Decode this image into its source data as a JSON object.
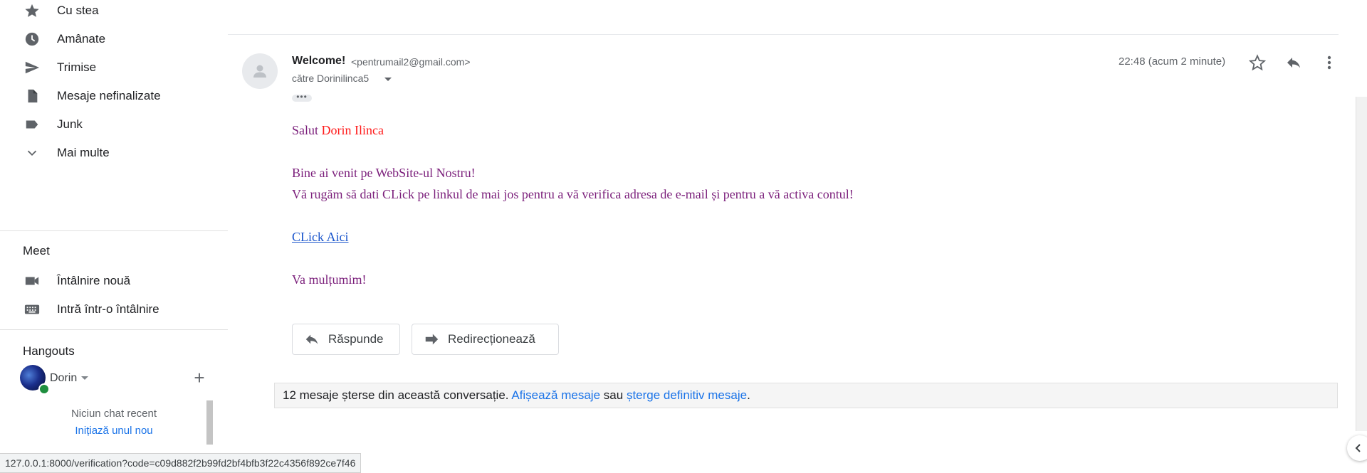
{
  "sidebar": {
    "items": [
      {
        "label": "Cu stea",
        "icon": "star-icon"
      },
      {
        "label": "Amânate",
        "icon": "clock-icon"
      },
      {
        "label": "Trimise",
        "icon": "send-icon"
      },
      {
        "label": "Mesaje nefinalizate",
        "icon": "draft-icon"
      },
      {
        "label": "Junk",
        "icon": "label-icon"
      },
      {
        "label": "Mai multe",
        "icon": "chevron-down-icon"
      }
    ],
    "meet": {
      "title": "Meet",
      "items": [
        {
          "label": "Întâlnire nouă",
          "icon": "video-icon"
        },
        {
          "label": "Intră într-o întâlnire",
          "icon": "keyboard-icon"
        }
      ]
    },
    "hangouts": {
      "title": "Hangouts",
      "user": "Dorin",
      "no_chat": "Niciun chat recent",
      "start_chat": "Inițiază unul nou"
    }
  },
  "message": {
    "sender_name": "Welcome!",
    "sender_email": "<pentrumail2@gmail.com>",
    "recipient": "către Dorinilinca5",
    "timestamp": "22:48 (acum 2 minute)",
    "greeting_prefix": "Salut ",
    "greeting_name": "Dorin Ilinca",
    "line1": "Bine ai venit pe WebSite-ul Nostru!",
    "line2": "Vă rugăm să dati CLick pe linkul de mai jos pentru a vă verifica adresa de e-mail și pentru a vă activa contul!",
    "link_text": "CLick Aici",
    "thanks": "Va mulțumim!"
  },
  "actions": {
    "reply": "Răspunde",
    "forward": "Redirecționează"
  },
  "deleted_notice": {
    "text": "12 mesaje șterse din această conversație.",
    "show": "Afișează mesaje",
    "or": "sau",
    "delete": "șterge definitiv mesaje",
    "end": "."
  },
  "status_bar": {
    "url": "127.0.0.1:8000/verification?code=c09d882f2b99fd2bf4bfb3f22c4356f892ce7f46"
  },
  "colors": {
    "body_text": "#7b1f7b",
    "name_red": "#ff1a1a",
    "link_blue": "#1a55cc",
    "accent_blue": "#1a73e8"
  }
}
